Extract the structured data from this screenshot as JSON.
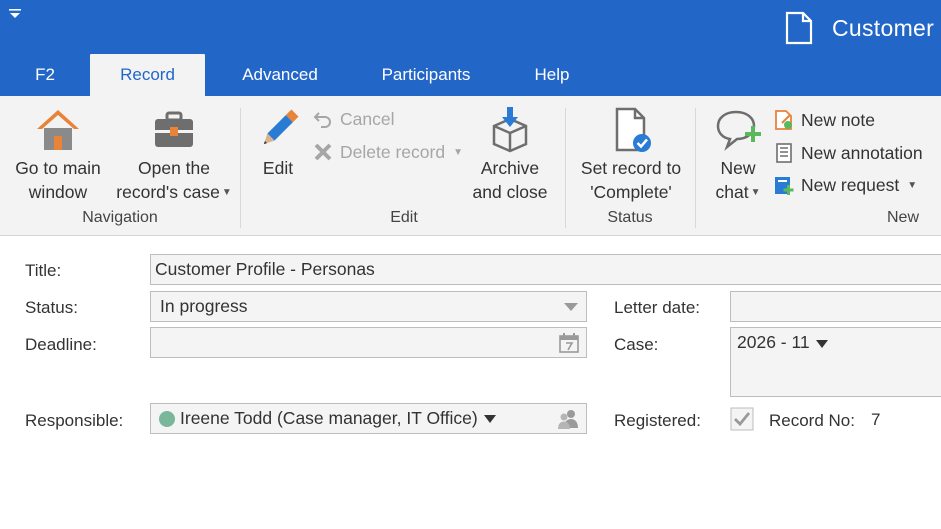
{
  "window": {
    "title": "Customer",
    "quick_access_icon": "dropdown-arrow-icon",
    "doc_icon": "document-icon"
  },
  "tabs": [
    {
      "label": "F2",
      "active": false
    },
    {
      "label": "Record",
      "active": true
    },
    {
      "label": "Advanced",
      "active": false
    },
    {
      "label": "Participants",
      "active": false
    },
    {
      "label": "Help",
      "active": false
    }
  ],
  "ribbon": {
    "navigation": {
      "group_label": "Navigation",
      "go_main_line1": "Go to main",
      "go_main_line2": "window",
      "open_case_line1": "Open the",
      "open_case_line2": "record's case"
    },
    "edit": {
      "group_label": "Edit",
      "edit_label": "Edit",
      "cancel_label": "Cancel",
      "delete_label": "Delete record",
      "archive_line1": "Archive",
      "archive_line2": "and close"
    },
    "status": {
      "group_label": "Status",
      "set_line1": "Set record to",
      "set_line2": "'Complete'"
    },
    "new": {
      "group_label": "New",
      "chat_line1": "New",
      "chat_line2": "chat",
      "note_label": "New note",
      "annotation_label": "New annotation",
      "request_label": "New request"
    }
  },
  "form": {
    "title_label": "Title:",
    "title_value": "Customer Profile - Personas",
    "status_label": "Status:",
    "status_value": "In progress",
    "deadline_label": "Deadline:",
    "deadline_value": "",
    "responsible_label": "Responsible:",
    "responsible_value": "Ireene Todd (Case manager, IT Office)",
    "letter_date_label": "Letter date:",
    "letter_date_value": "",
    "case_label": "Case:",
    "case_value": "2026 - 11",
    "registered_label": "Registered:",
    "registered_checked": true,
    "record_no_label": "Record No:",
    "record_no_value": "7"
  },
  "colors": {
    "brand_blue": "#2266c8",
    "ribbon_bg": "#f3f3f3",
    "home_orange": "#e8833a",
    "accent_green": "#5cb85c",
    "icon_blue": "#2a7bd4"
  }
}
